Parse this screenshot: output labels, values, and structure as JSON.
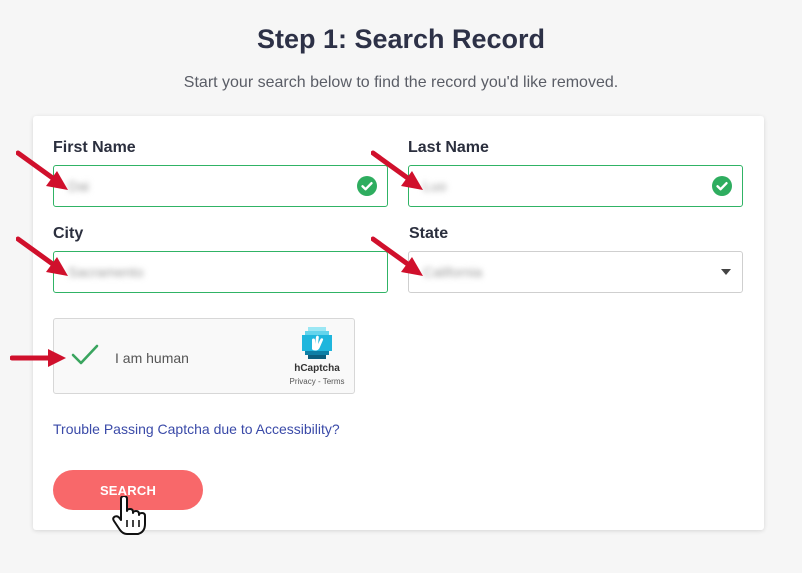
{
  "page": {
    "title": "Step 1: Search Record",
    "subtitle": "Start your search below to find the record you'd like removed."
  },
  "form": {
    "first_name": {
      "label": "First Name",
      "value": "Dai"
    },
    "last_name": {
      "label": "Last Name",
      "value": "Luo"
    },
    "city": {
      "label": "City",
      "value": "Sacramento"
    },
    "state": {
      "label": "State",
      "value": "California"
    }
  },
  "captcha": {
    "label": "I am human",
    "brand": "hCaptcha",
    "links": "Privacy - Terms"
  },
  "trouble_link": "Trouble Passing Captcha due to Accessibility?",
  "search_button": "SEARCH",
  "colors": {
    "accent_green": "#30b365",
    "button_red": "#f8686a",
    "arrow_red": "#d0102c",
    "link_blue": "#3a4aa8"
  },
  "icons": [
    "check-circle-icon",
    "caret-down-icon",
    "checkmark-icon",
    "hcaptcha-logo",
    "annotation-arrow",
    "hand-cursor-icon"
  ]
}
